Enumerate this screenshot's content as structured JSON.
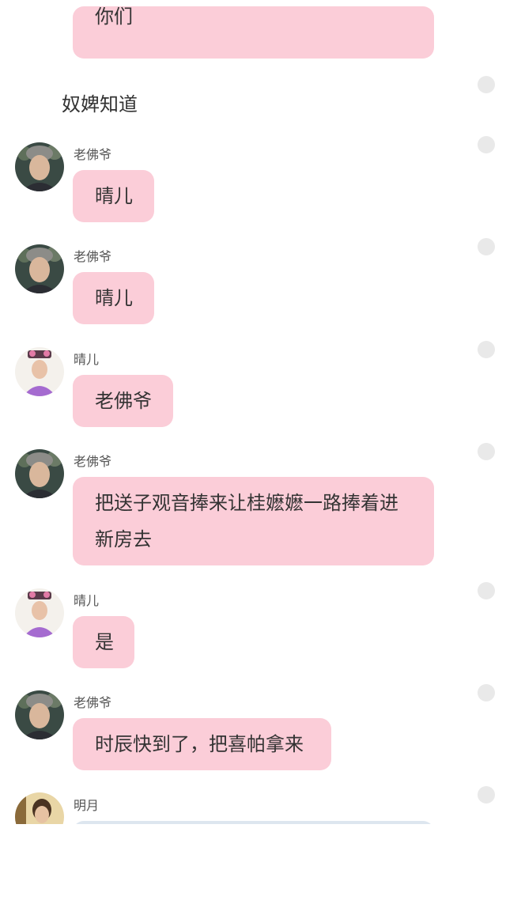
{
  "messages": [
    {
      "type": "bubble",
      "text": "你们"
    },
    {
      "type": "text",
      "text": "奴婢知道"
    },
    {
      "type": "bubble",
      "sender": "老佛爷",
      "avatar": "old-lady-avatar",
      "text": "晴儿"
    },
    {
      "type": "bubble",
      "sender": "老佛爷",
      "avatar": "old-lady-avatar",
      "text": "晴儿"
    },
    {
      "type": "bubble",
      "sender": "晴儿",
      "avatar": "princess-avatar",
      "text": "老佛爷"
    },
    {
      "type": "bubble",
      "sender": "老佛爷",
      "avatar": "old-lady-avatar",
      "text": "把送子观音捧来让桂嬷嬷一路捧着进新房去"
    },
    {
      "type": "bubble",
      "sender": "晴儿",
      "avatar": "princess-avatar",
      "text": "是"
    },
    {
      "type": "bubble",
      "sender": "老佛爷",
      "avatar": "old-lady-avatar",
      "text": "时辰快到了，把喜帕拿来"
    },
    {
      "type": "bubble",
      "sender": "明月",
      "avatar": "mingyue-avatar",
      "text": ""
    }
  ],
  "colors": {
    "bubble": "#fbcdd8",
    "bubble_alt": "#dde6ef",
    "check": "#e9e9e9",
    "background": "#ffffff"
  }
}
